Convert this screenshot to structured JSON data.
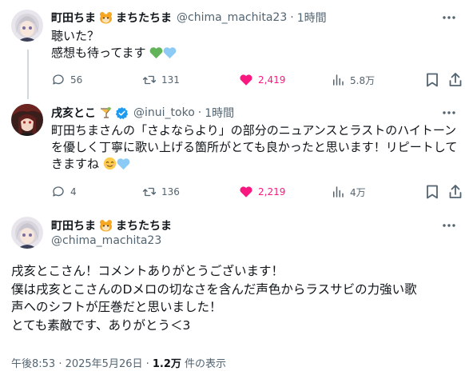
{
  "colors": {
    "accent": "#1d9bf0",
    "like": "#f91880",
    "muted": "#536471",
    "line": "#cfd9de"
  },
  "tweet1": {
    "name": "町田ちま",
    "name_suffix": "まちたちま",
    "handle": "@chima_machita23",
    "time": "1時間",
    "lines": [
      "聴いた？",
      "感想も待ってます"
    ],
    "replies": "56",
    "retweets": "131",
    "likes": "2,419",
    "views": "5.8万"
  },
  "tweet2": {
    "name": "戌亥とこ",
    "handle": "@inui_toko",
    "time": "1時間",
    "lines": [
      "町田ちまさんの「さよならより」の部分のニュアンスとラストのハイトーン",
      "を優しく丁寧に歌い上げる箇所がとても良かったと思います！リピートして",
      "きますね"
    ],
    "replies": "4",
    "retweets": "136",
    "likes": "2,219",
    "views": "4万"
  },
  "tweet3": {
    "name": "町田ちま",
    "name_suffix": "まちたちま",
    "handle": "@chima_machita23",
    "lines": [
      "戌亥とこさん！コメントありがとうございます！",
      "僕は戌亥とこさんのDメロの切なさを含んだ声色からラスサビの力強い歌",
      "声へのシフトが圧巻だと思いました！",
      "とても素敵です、ありがとう＜3"
    ],
    "timestamp": "午後8:53 · 2025年5月26日 · ",
    "views_count": "1.2万",
    "views_label": " 件の表示"
  }
}
